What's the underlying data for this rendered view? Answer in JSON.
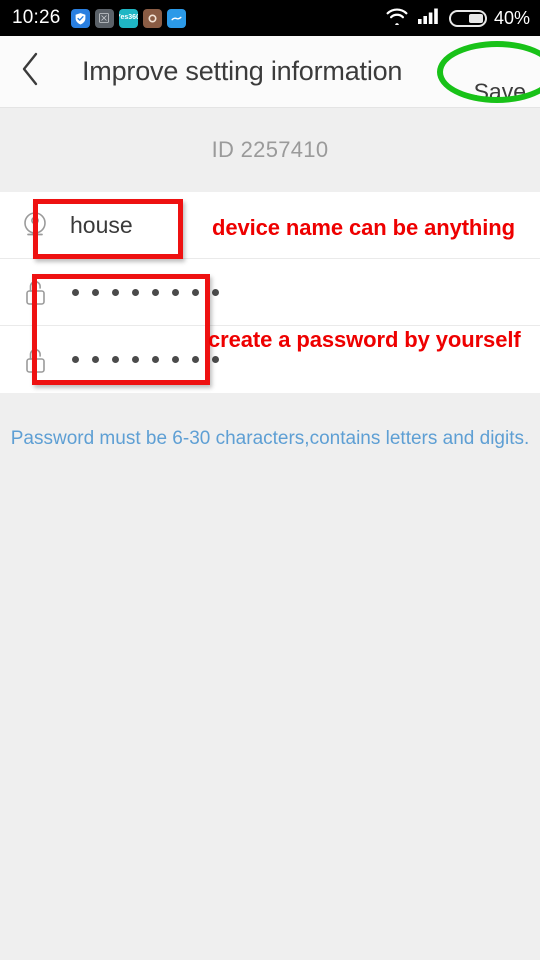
{
  "status_bar": {
    "clock": "10:26",
    "battery_percent": "40%",
    "icons": [
      {
        "name": "shield-app-icon",
        "glyph": "✔"
      },
      {
        "name": "gray-app-icon",
        "glyph": "▦"
      },
      {
        "name": "yes360-app-icon",
        "glyph": "Yes 360"
      },
      {
        "name": "brown-circle-app-icon",
        "glyph": "○"
      },
      {
        "name": "messenger-app-icon",
        "glyph": "∿"
      }
    ],
    "wifi_icon": "wifi-icon",
    "signal_icon": "cellular-signal-icon",
    "battery_icon": "battery-icon"
  },
  "header": {
    "back_icon": "chevron-left-icon",
    "title": "Improve setting information",
    "save_label": "Save"
  },
  "id_strip": {
    "id_text": "ID 2257410"
  },
  "form": {
    "rows": [
      {
        "name": "device-name-row",
        "icon": "webcam-icon",
        "value": "house",
        "masked": false
      },
      {
        "name": "password-row",
        "icon": "unlock-icon",
        "value": "••••••••",
        "masked": true,
        "dot_count": 8
      },
      {
        "name": "confirm-password-row",
        "icon": "unlock-icon",
        "value": "••••••••",
        "masked": true,
        "dot_count": 8
      }
    ]
  },
  "hint": {
    "text": "Password must be 6-30 characters,contains letters and digits."
  },
  "annotations": {
    "device_name_note": "device name can be anything",
    "password_note": "create a password by yourself",
    "box_color": "#ee1111",
    "ellipse_color": "#18c218",
    "text_color": "#ee0000"
  },
  "colors": {
    "page_background": "#efefef",
    "content_background": "#ffffff",
    "header_background": "#fbfbfb",
    "status_bar_background": "#000000",
    "hint_blue": "#5e9fd4",
    "id_gray": "#9a9a9a",
    "title_gray": "#3b3b3b"
  }
}
